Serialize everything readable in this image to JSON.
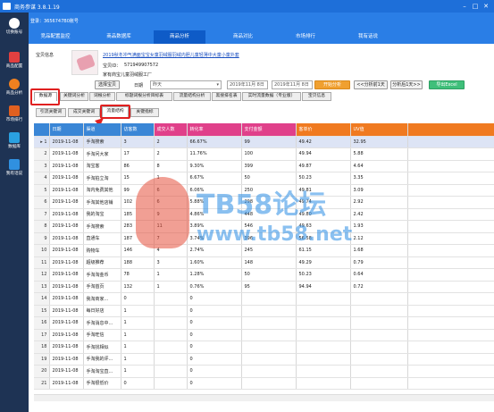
{
  "app": {
    "title": "商务参谋 3.8.1.19",
    "status_text": "登录：3656747B0账号"
  },
  "sidebar": {
    "items": [
      {
        "label": "切换账号",
        "icon": "user-switch-icon",
        "color": "#2a7ee6"
      },
      {
        "label": "商品配置",
        "icon": "shop-icon",
        "color": "#e04040"
      },
      {
        "label": "商品分析",
        "icon": "eye-icon",
        "color": "#f08020"
      },
      {
        "label": "市场排行",
        "icon": "rank-icon",
        "color": "#e06020"
      },
      {
        "label": "数据库",
        "icon": "database-icon",
        "color": "#2aa0e0"
      },
      {
        "label": "我有话说",
        "icon": "chat-icon",
        "color": "#3090e0"
      }
    ]
  },
  "nav": {
    "items": [
      "竞品配置监控",
      "商品数据库",
      "商品分析",
      "商品对比",
      "市场排行",
      "我有话说"
    ],
    "active_index": 2
  },
  "product": {
    "section_label": "宝贝信息",
    "title_link": "2019秋冬冲气满面宝宝女童羽绒服羽绒内胆儿童轻薄中大童小童外套",
    "id_label": "宝贝ID：",
    "id_value": "571949907572",
    "shop_label": "家有商宝儿童羽绒服工厂"
  },
  "toolbar": {
    "select_button": "选择宝贝",
    "date_label": "日期",
    "date_value": "昨天",
    "date_start": "2019年11月 8日",
    "date_end": "2019年11月 8日",
    "start_button": "开始分析",
    "prev_button": "<<分析前1天",
    "next_button": "分析后1天>>",
    "export_button": "导出Excel"
  },
  "tabs": {
    "main": [
      "数据源",
      "关键词分析",
      "词根分析",
      "标题词根分析目标表",
      "流量结构分析",
      "黑搜排名表",
      "实时流量数据（专业版）",
      "宝贝信息"
    ],
    "active_main": 0,
    "sub": [
      "引流关键词",
      "成交关键词",
      "流量结构",
      "关键指标"
    ],
    "active_sub": 2
  },
  "table": {
    "columns": [
      {
        "label": "日期",
        "color": "#3a86d6"
      },
      {
        "label": "渠道",
        "color": "#3a86d6"
      },
      {
        "label": "访客数",
        "color": "#3a86d6"
      },
      {
        "label": "成交人数",
        "color": "#e0408a"
      },
      {
        "label": "转化率",
        "color": "#e0408a"
      },
      {
        "label": "支付金额",
        "color": "#e0408a"
      },
      {
        "label": "客单价",
        "color": "#f07a20"
      },
      {
        "label": "UV值",
        "color": "#f07a20"
      }
    ],
    "rows": [
      [
        "2019-11-08",
        "手淘搜索",
        "3",
        "2",
        "66.67%",
        "99",
        "49.42",
        "32.95"
      ],
      [
        "2019-11-08",
        "手淘问大家",
        "17",
        "2",
        "11.76%",
        "100",
        "49.94",
        "5.88"
      ],
      [
        "2019-11-08",
        "淘宝客",
        "86",
        "8",
        "9.30%",
        "399",
        "49.87",
        "4.64"
      ],
      [
        "2019-11-08",
        "手淘拍立淘",
        "15",
        "1",
        "6.67%",
        "50",
        "50.23",
        "3.35"
      ],
      [
        "2019-11-08",
        "淘内免费其他",
        "99",
        "6",
        "6.06%",
        "250",
        "49.81",
        "3.09"
      ],
      [
        "2019-11-08",
        "手淘其他店铺",
        "102",
        "6",
        "5.88%",
        "298",
        "49.74",
        "2.92"
      ],
      [
        "2019-11-08",
        "我的淘宝",
        "185",
        "9",
        "4.86%",
        "448",
        "49.80",
        "2.42"
      ],
      [
        "2019-11-08",
        "手淘搜索",
        "283",
        "11",
        "3.89%",
        "546",
        "49.63",
        "1.93"
      ],
      [
        "2019-11-08",
        "直通车",
        "187",
        "7",
        "3.74%",
        "396",
        "56.58",
        "2.12"
      ],
      [
        "2019-11-08",
        "购物车",
        "146",
        "4",
        "2.74%",
        "245",
        "61.15",
        "1.68"
      ],
      [
        "2019-11-08",
        "超级推荐",
        "188",
        "3",
        "1.60%",
        "148",
        "49.29",
        "0.79"
      ],
      [
        "2019-11-08",
        "手淘淘金币",
        "78",
        "1",
        "1.28%",
        "50",
        "50.23",
        "0.64"
      ],
      [
        "2019-11-08",
        "手淘首页",
        "132",
        "1",
        "0.76%",
        "95",
        "94.94",
        "0.72"
      ],
      [
        "2019-11-08",
        "我淘商家...",
        "0",
        "",
        "0",
        "",
        "",
        ""
      ],
      [
        "2019-11-08",
        "每日好店",
        "1",
        "",
        "0",
        "",
        "",
        ""
      ],
      [
        "2019-11-08",
        "手淘消息中...",
        "1",
        "",
        "0",
        "",
        "",
        ""
      ],
      [
        "2019-11-08",
        "手淘旺信",
        "1",
        "",
        "0",
        "",
        "",
        ""
      ],
      [
        "2019-11-08",
        "手淘找相似",
        "1",
        "",
        "0",
        "",
        "",
        ""
      ],
      [
        "2019-11-08",
        "手淘我的评...",
        "1",
        "",
        "0",
        "",
        "",
        ""
      ],
      [
        "2019-11-08",
        "手淘淘宝直...",
        "1",
        "",
        "0",
        "",
        "",
        ""
      ],
      [
        "2019-11-08",
        "手淘很低价",
        "0",
        "",
        "0",
        "",
        "",
        ""
      ]
    ]
  },
  "watermark": {
    "text": "TB58论坛",
    "url": "www.tb58.net"
  }
}
